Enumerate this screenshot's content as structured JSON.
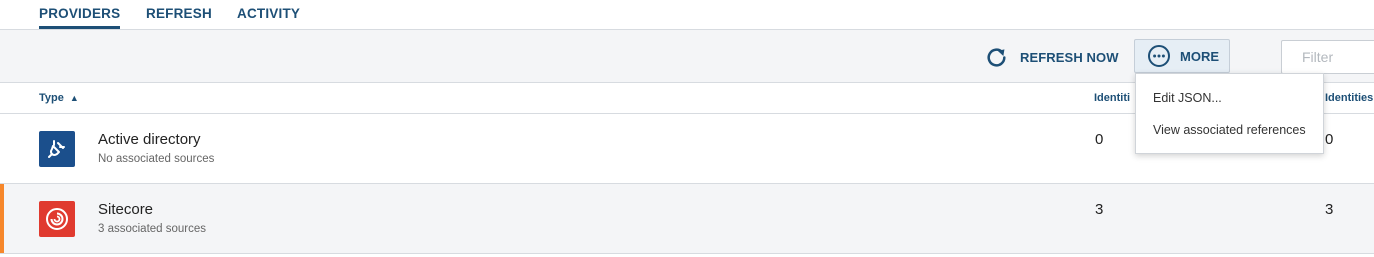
{
  "tabs": [
    {
      "label": "PROVIDERS",
      "active": true
    },
    {
      "label": "REFRESH",
      "active": false
    },
    {
      "label": "ACTIVITY",
      "active": false
    }
  ],
  "toolbar": {
    "refresh_label": "REFRESH NOW",
    "refresh_icon": "refresh-icon",
    "more_label": "MORE",
    "more_icon": "ellipsis-circle-icon",
    "filter_placeholder": "Filter"
  },
  "more_menu": {
    "items": [
      "Edit JSON...",
      "View associated references"
    ]
  },
  "table": {
    "columns": {
      "type": "Type",
      "sort_indicator": "▲",
      "identities_a": "Identiti",
      "identities_b": "Identities"
    },
    "rows": [
      {
        "name": "Active directory",
        "subtitle": "No associated sources",
        "icon": "plug-icon",
        "icon_color": "#1b4f8c",
        "identities_a": "0",
        "identities_b": "0",
        "selected": false
      },
      {
        "name": "Sitecore",
        "subtitle": "3 associated sources",
        "icon": "sitecore-logo-icon",
        "icon_color": "#e03a2f",
        "identities_a": "3",
        "identities_b": "3",
        "selected": true
      }
    ]
  },
  "colors": {
    "accent": "#1d4f76",
    "selection_marker": "#f6872b",
    "toolbar_bg": "#f4f5f7"
  }
}
